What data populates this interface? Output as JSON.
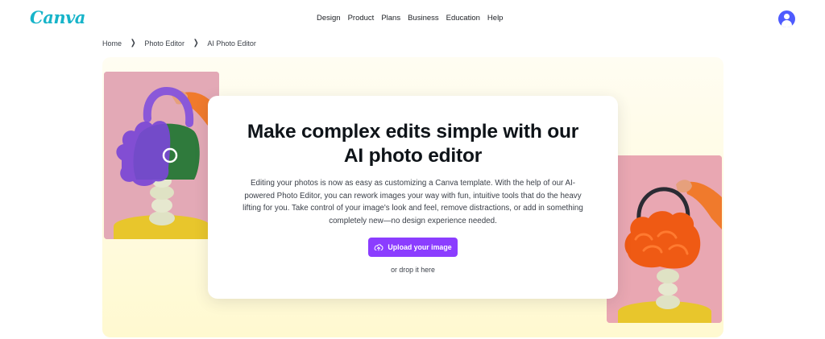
{
  "header": {
    "logo": "Canva",
    "nav": [
      "Design",
      "Product",
      "Plans",
      "Business",
      "Education",
      "Help"
    ],
    "avatar_icon": "user-avatar-icon"
  },
  "breadcrumb": [
    "Home",
    "Photo Editor",
    "AI Photo Editor"
  ],
  "hero": {
    "headline_line1": "Make complex edits simple with our",
    "headline_line2": "AI photo editor",
    "description": "Editing your photos is now as easy as customizing a Canva template. With the help of our AI-powered Photo Editor, you can rework images your way with fun, intuitive tools that do the heavy lifting for you. Take control of your image's look and feel, remove distractions, or add in something completely new—no design experience needed.",
    "upload_label": "Upload your image",
    "upload_icon": "cloud-upload-icon",
    "drop_text": "or drop it here"
  },
  "colors": {
    "accent": "#8b3dff",
    "logo_teal": "#17b4c9",
    "hero_bg": "#fffbe2",
    "photo_pink": "#e3a9b6"
  }
}
